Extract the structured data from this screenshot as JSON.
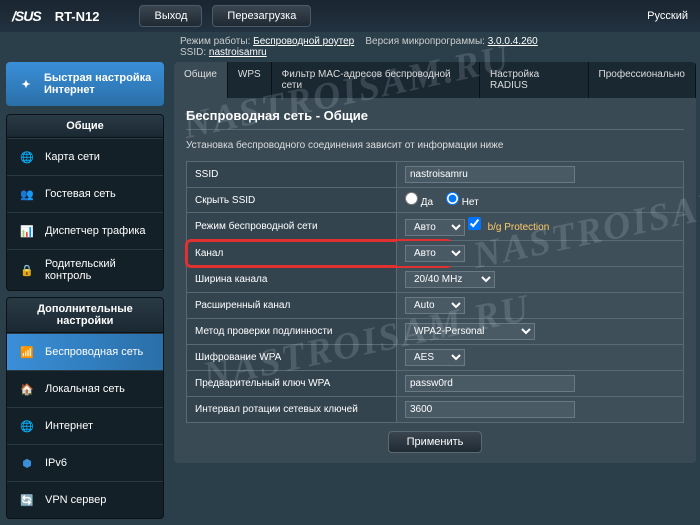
{
  "header": {
    "brand": "/SUS",
    "model": "RT-N12",
    "logout": "Выход",
    "reboot": "Перезагрузка",
    "language": "Русский"
  },
  "info": {
    "mode_label": "Режим работы:",
    "mode_value": "Беспроводной роутер",
    "fw_label": "Версия микропрограммы:",
    "fw_value": "3.0.0.4.260",
    "ssid_label": "SSID:",
    "ssid_value": "nastroisamru"
  },
  "sidebar": {
    "quick_setup": "Быстрая настройка Интернет",
    "general_header": "Общие",
    "general": [
      "Карта сети",
      "Гостевая сеть",
      "Диспетчер трафика",
      "Родительский контроль"
    ],
    "advanced_header": "Дополнительные настройки",
    "advanced": [
      "Беспроводная сеть",
      "Локальная сеть",
      "Интернет",
      "IPv6",
      "VPN сервер"
    ]
  },
  "tabs": [
    "Общие",
    "WPS",
    "Фильтр MAC-адресов беспроводной сети",
    "Настройка RADIUS",
    "Профессионально"
  ],
  "panel": {
    "title": "Беспроводная сеть - Общие",
    "desc": "Установка беспроводного соединения зависит от информации ниже",
    "rows": {
      "ssid_label": "SSID",
      "ssid_value": "nastroisamru",
      "hide_label": "Скрыть SSID",
      "hide_yes": "Да",
      "hide_no": "Нет",
      "mode_label": "Режим беспроводной сети",
      "mode_value": "Авто",
      "bgprot": "b/g Protection",
      "channel_label": "Канал",
      "channel_value": "Авто",
      "bw_label": "Ширина канала",
      "bw_value": "20/40 MHz",
      "ext_label": "Расширенный канал",
      "ext_value": "Auto",
      "auth_label": "Метод проверки подлинности",
      "auth_value": "WPA2-Personal",
      "enc_label": "Шифрование WPA",
      "enc_value": "AES",
      "psk_label": "Предварительный ключ WPA",
      "psk_value": "passw0rd",
      "rekey_label": "Интервал ротации сетевых ключей",
      "rekey_value": "3600"
    },
    "apply": "Применить"
  },
  "watermark": "NASTROISAM.RU"
}
